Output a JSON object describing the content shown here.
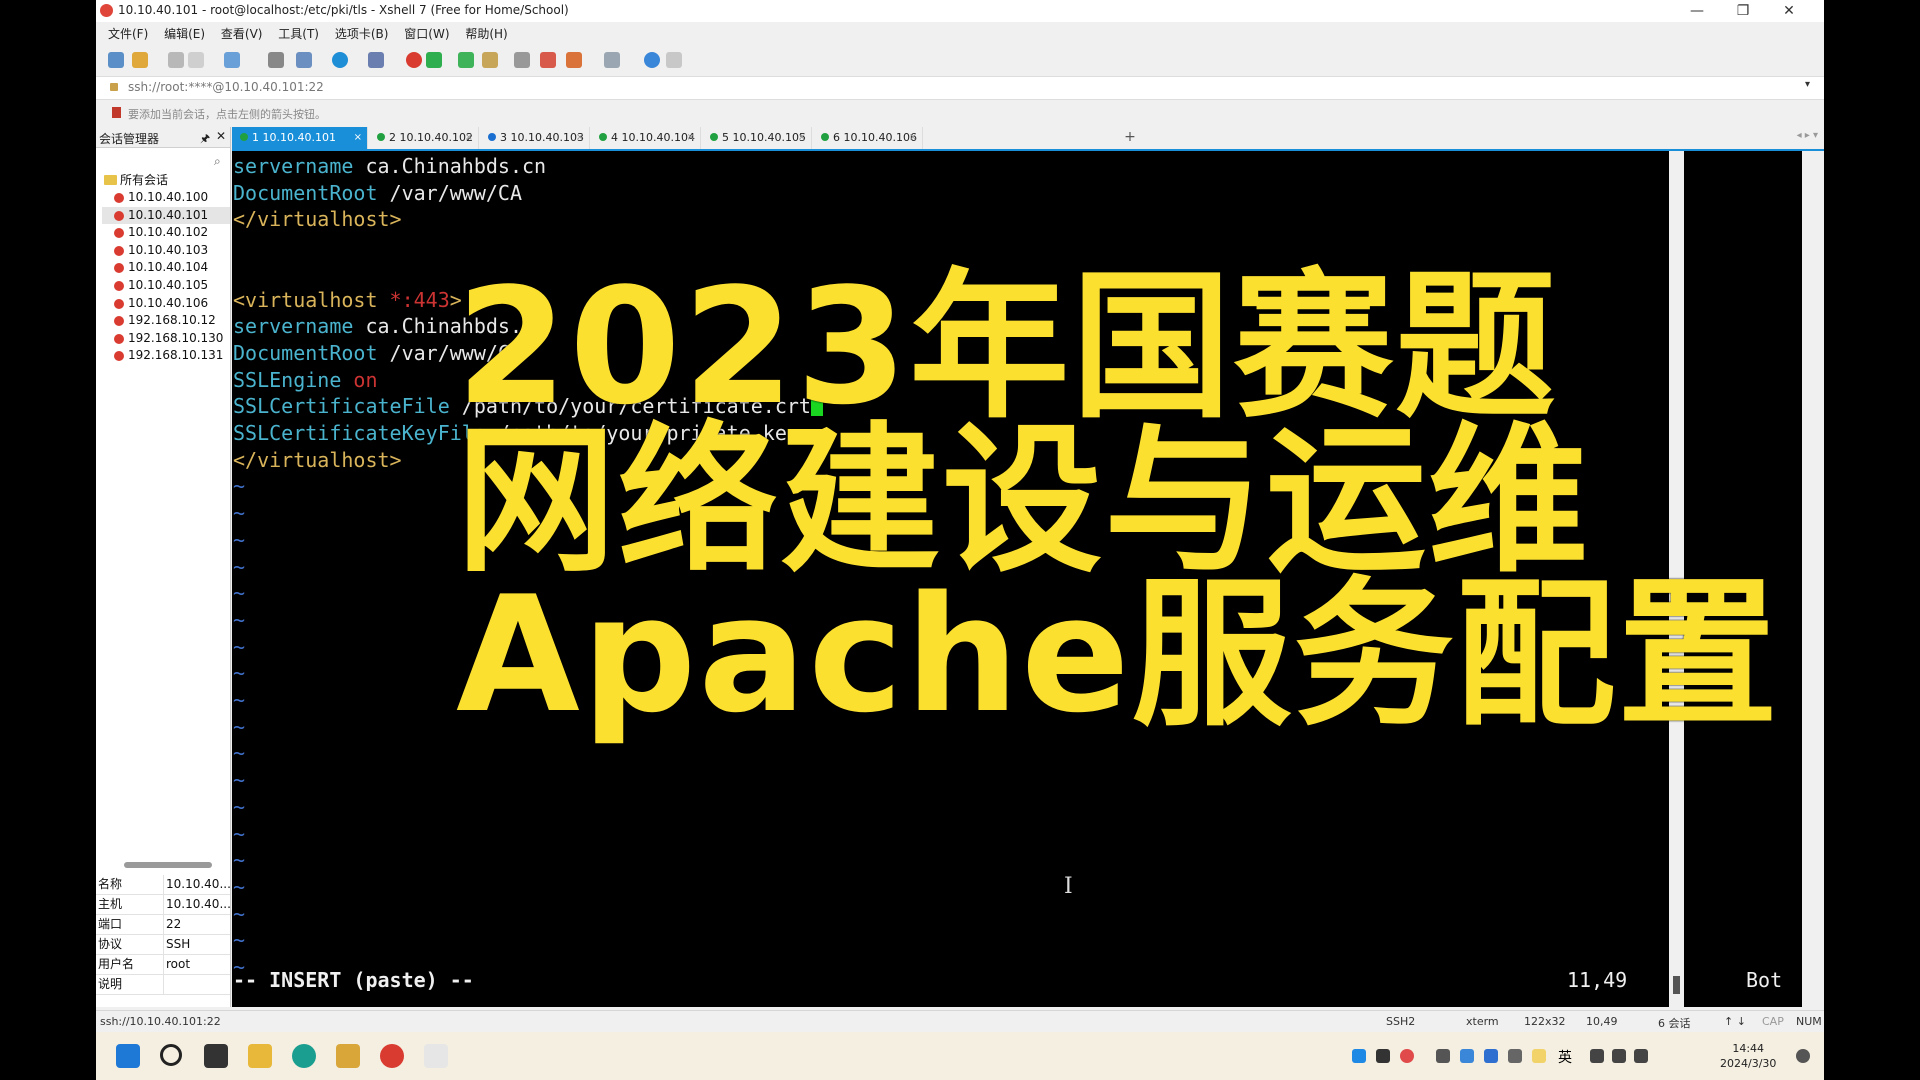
{
  "window": {
    "title": "10.10.40.101 - root@localhost:/etc/pki/tls - Xshell 7 (Free for Home/School)",
    "minimize_glyph": "—",
    "restore_glyph": "❐",
    "close_glyph": "✕"
  },
  "menu": [
    "文件(F)",
    "编辑(E)",
    "查看(V)",
    "工具(T)",
    "选项卡(B)",
    "窗口(W)",
    "帮助(H)"
  ],
  "address": {
    "text": "ssh://root:****@10.10.40.101:22",
    "dropdown": "▾"
  },
  "hint": {
    "text": "要添加当前会话，点击左侧的箭头按钮。"
  },
  "session_manager": {
    "title": "会话管理器",
    "pin": "🖈",
    "close": "✕",
    "search_icon": "⌕",
    "root_label": "所有会话",
    "sessions": [
      "10.10.40.100",
      "10.10.40.101",
      "10.10.40.102",
      "10.10.40.103",
      "10.10.40.104",
      "10.10.40.105",
      "10.10.40.106",
      "192.168.10.12",
      "192.168.10.130",
      "192.168.10.131"
    ],
    "selected": "10.10.40.101"
  },
  "properties": [
    {
      "key": "名称",
      "value": "10.10.40...."
    },
    {
      "key": "主机",
      "value": "10.10.40...."
    },
    {
      "key": "端口",
      "value": "22"
    },
    {
      "key": "协议",
      "value": "SSH"
    },
    {
      "key": "用户名",
      "value": "root"
    },
    {
      "key": "说明",
      "value": ""
    }
  ],
  "tabs": [
    {
      "label": "1 10.10.40.101",
      "active": true,
      "status": "connected"
    },
    {
      "label": "2 10.10.40.102",
      "active": false,
      "status": "connected"
    },
    {
      "label": "3 10.10.40.103",
      "active": false,
      "status": "info"
    },
    {
      "label": "4 10.10.40.104",
      "active": false,
      "status": "connected"
    },
    {
      "label": "5 10.10.40.105",
      "active": false,
      "status": "connected"
    },
    {
      "label": "6 10.10.40.106",
      "active": false,
      "status": "connected"
    }
  ],
  "tab_close": "×",
  "tab_add": "+",
  "tab_nav": "◂ ▸ ▾",
  "terminal": {
    "lines": [
      {
        "parts": [
          {
            "t": "servername ",
            "c": "cy"
          },
          {
            "t": "ca.Chinahbds.cn",
            "c": "wh"
          }
        ]
      },
      {
        "parts": [
          {
            "t": "DocumentRoot ",
            "c": "cy"
          },
          {
            "t": "/var/www/CA",
            "c": "wh"
          }
        ]
      },
      {
        "parts": [
          {
            "t": "</virtualhost>",
            "c": "yl"
          }
        ]
      },
      {
        "parts": []
      },
      {
        "parts": []
      },
      {
        "parts": [
          {
            "t": "<virtualhost ",
            "c": "yl"
          },
          {
            "t": "*:443",
            "c": "rd"
          },
          {
            "t": ">",
            "c": "yl"
          }
        ]
      },
      {
        "parts": [
          {
            "t": "servername ",
            "c": "cy"
          },
          {
            "t": "ca.Chinahbds.cn",
            "c": "wh"
          }
        ]
      },
      {
        "parts": [
          {
            "t": "DocumentRoot ",
            "c": "cy"
          },
          {
            "t": "/var/www/CA",
            "c": "wh"
          }
        ]
      },
      {
        "parts": [
          {
            "t": "SSLEngine ",
            "c": "cy"
          },
          {
            "t": "on",
            "c": "rd"
          }
        ]
      },
      {
        "parts": [
          {
            "t": "SSLCertificateFile ",
            "c": "cy"
          },
          {
            "t": "/path/to/your/certificate.crt",
            "c": "wh"
          }
        ],
        "cursor": true
      },
      {
        "parts": [
          {
            "t": "SSLCertificateKeyFile ",
            "c": "cy"
          },
          {
            "t": "/path/to/your/private.key",
            "c": "wh"
          }
        ]
      },
      {
        "parts": [
          {
            "t": "</virtualhost>",
            "c": "yl"
          }
        ]
      }
    ],
    "tilde": "~",
    "tilde_count": 19,
    "mode": "-- INSERT (paste) --",
    "position": "11,49",
    "scroll": "Bot",
    "ibeam": "I"
  },
  "overlay": {
    "line1": "2023年国赛题",
    "line2": "网络建设与运维",
    "line3": "Apache服务配置"
  },
  "statusbar": {
    "left": "ssh://10.10.40.101:22",
    "protocol": "SSH2",
    "term": "xterm",
    "size": "122x32",
    "cursor": "10,49",
    "sessions": "6 会话",
    "arrows": "↑ ↓",
    "caps": "CAP",
    "num": "NUM"
  },
  "taskbar": {
    "ime": "英",
    "time": "14:44",
    "date": "2024/3/30"
  },
  "colors": {
    "accent": "#1a8fd9",
    "overlay_yellow": "#fce030",
    "terminal_cyan": "#4ab3cd",
    "terminal_yellow": "#d9b45a",
    "cursor_green": "#1bd620"
  }
}
